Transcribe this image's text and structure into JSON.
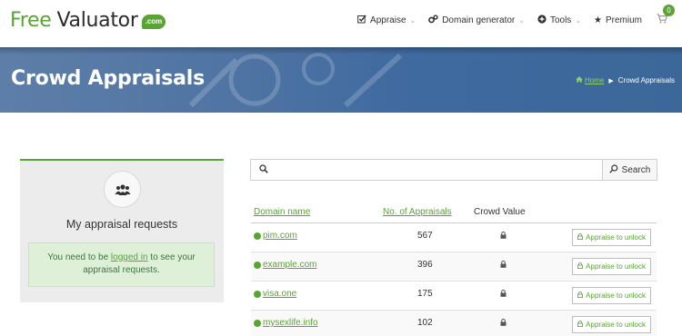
{
  "header": {
    "logo_free": "Free",
    "logo_valuator": "Valuator",
    "logo_badge": ".com",
    "nav": [
      {
        "label": "Appraise",
        "icon": "check-square-icon"
      },
      {
        "label": "Domain generator",
        "icon": "gears-icon"
      },
      {
        "label": "Tools",
        "icon": "plus-circle-icon"
      },
      {
        "label": "Premium",
        "icon": "star-icon"
      }
    ],
    "cart_count": "0"
  },
  "banner": {
    "title": "Crowd Appraisals",
    "breadcrumb_home": "Home",
    "breadcrumb_current": "Crowd Appraisals"
  },
  "sidebar": {
    "title": "My appraisal requests",
    "alert_prefix": "You need to be ",
    "alert_link": "logged in",
    "alert_suffix": " to see your appraisal requests."
  },
  "search": {
    "placeholder": "",
    "button_label": "Search"
  },
  "table": {
    "headers": {
      "domain": "Domain name",
      "count": "No. of Appraisals",
      "value": "Crowd Value"
    },
    "unlock_label": "Appraise to unlock",
    "rows": [
      {
        "domain": "pim.com",
        "count": "567"
      },
      {
        "domain": "example.com",
        "count": "396"
      },
      {
        "domain": "visa.one",
        "count": "175"
      },
      {
        "domain": "mysexlife.info",
        "count": "102"
      }
    ]
  },
  "colors": {
    "brand_green": "#5aa335",
    "banner_blue": "#4f74a3",
    "alert_bg": "#dff0d8"
  }
}
